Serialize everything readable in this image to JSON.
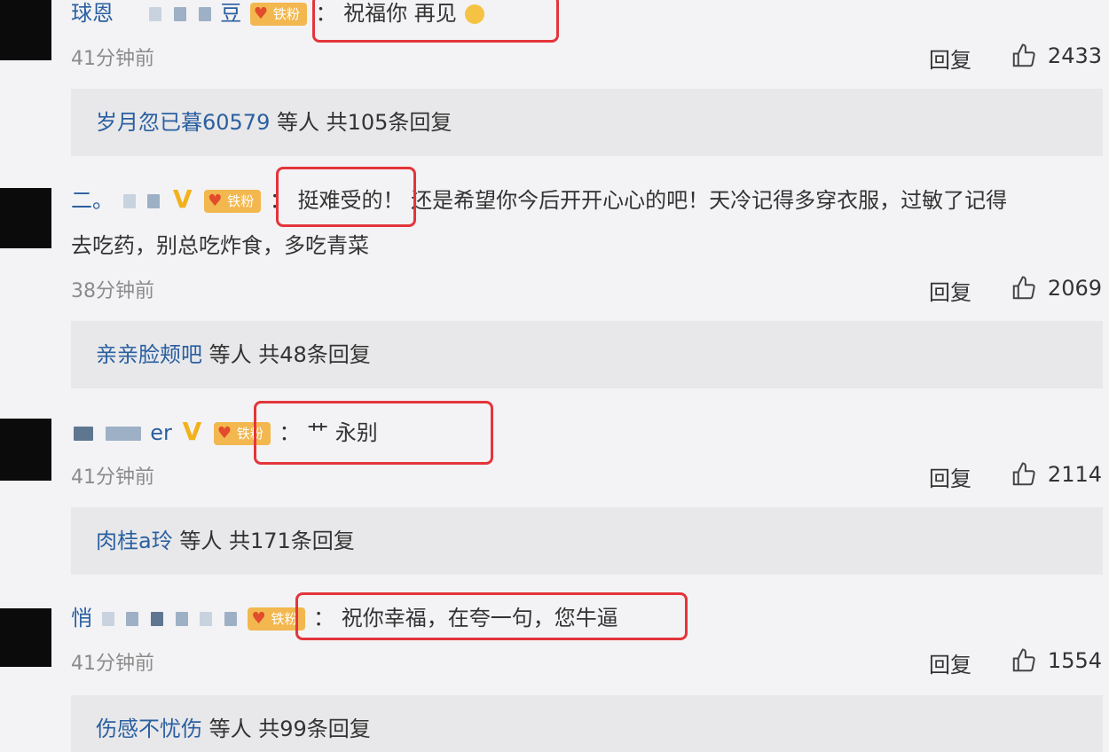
{
  "comments": [
    {
      "username": "球恩",
      "username_suffix": "豆",
      "badge": "铁粉",
      "text": "祝福你 再见",
      "time": "41分钟前",
      "reply_label": "回复",
      "likes": "2433",
      "summary": {
        "names": "岁月忽已暮60579",
        "rest": "等人 共105条回复"
      }
    },
    {
      "username": "二。",
      "badge": "铁粉",
      "vbadge": "V",
      "text_highlight": "挺难受的！",
      "text_line1": "还是希望你今后开开心心的吧！天冷记得多穿衣服，过敏了记得",
      "text_line2": "去吃药，别总吃炸食，多吃青菜",
      "time": "38分钟前",
      "reply_label": "回复",
      "likes": "2069",
      "summary": {
        "names": "亲亲脸颊吧",
        "rest": "等人 共48条回复"
      }
    },
    {
      "username_suffix": "er",
      "vbadge": "V",
      "badge": "铁粉",
      "text": "艹 永别",
      "time": "41分钟前",
      "reply_label": "回复",
      "likes": "2114",
      "summary": {
        "names": "肉桂a玲",
        "rest": "等人 共171条回复"
      }
    },
    {
      "username": "悄",
      "badge": "铁粉",
      "text": "祝你幸福，在夸一句，您牛逼",
      "time": "41分钟前",
      "reply_label": "回复",
      "likes": "1554",
      "summary": {
        "names": "伤感不忧伤",
        "rest": "等人 共99条回复"
      }
    }
  ],
  "colors": {
    "highlight": "#e3353b",
    "username": "#2a5fa0",
    "summary_bg": "#e8e8ea",
    "page_bg": "#f3f3f5"
  }
}
